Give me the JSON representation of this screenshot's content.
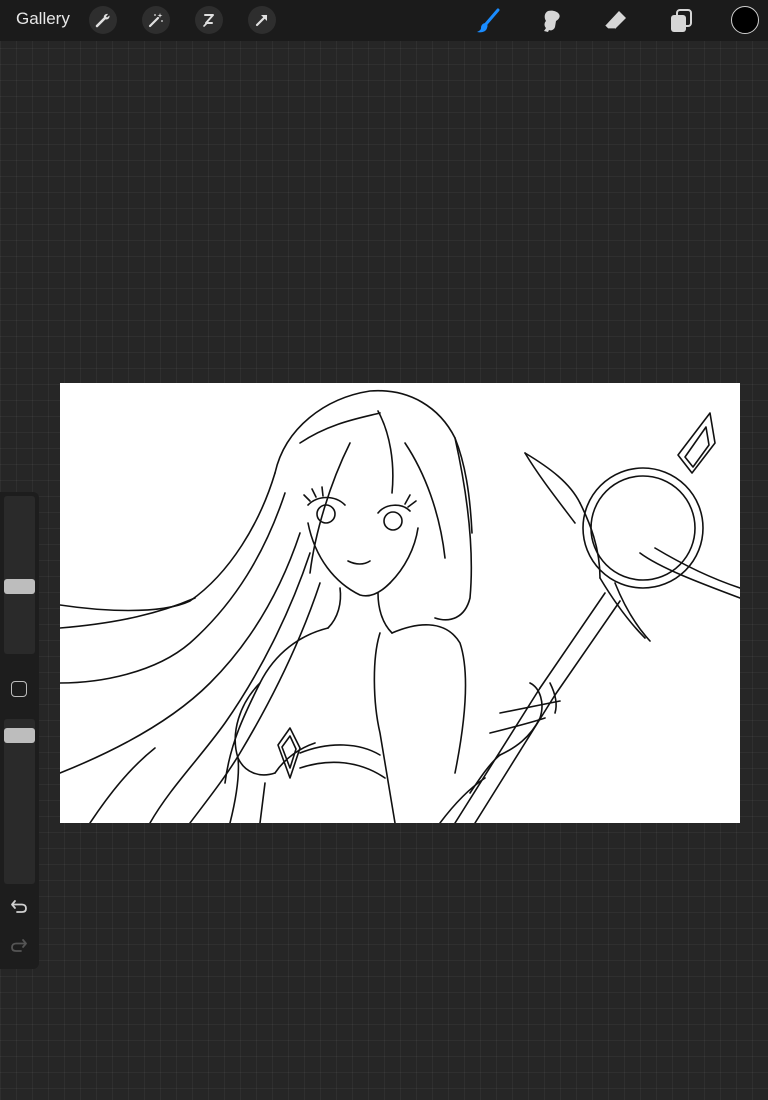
{
  "toolbar": {
    "gallery_label": "Gallery",
    "left_tools": [
      "wrench-icon",
      "magic-wand-icon",
      "selection-icon",
      "transform-arrow-icon"
    ],
    "right_tools": [
      "brush-icon",
      "smudge-icon",
      "eraser-icon",
      "layers-icon"
    ],
    "active_tool": "brush-icon",
    "accent_color": "#1a8cff",
    "current_color": "#000000"
  },
  "sidebar": {
    "brush_size_level": 0.58,
    "opacity_level": 0.17,
    "buttons": [
      "modify-button",
      "undo-button",
      "redo-button"
    ]
  }
}
